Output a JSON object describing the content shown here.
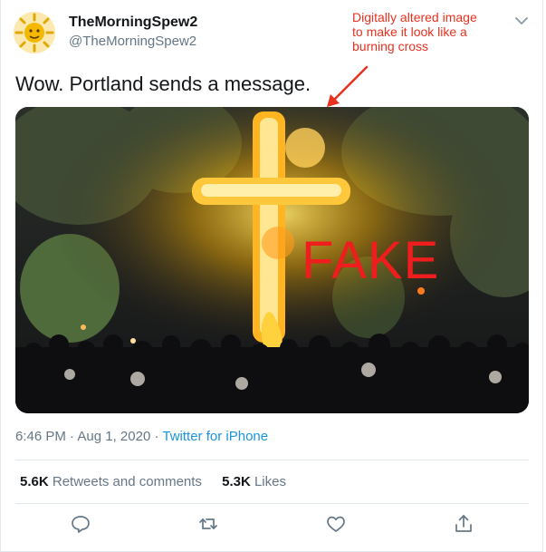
{
  "user": {
    "display_name": "TheMorningSpew2",
    "handle": "@TheMorningSpew2",
    "avatar_icon": "sun-face-icon"
  },
  "annotation": {
    "text": "Digitally  altered image\nto  make it look like a\nburning cross",
    "color": "#e8311f"
  },
  "tweet": {
    "text": "Wow. Portland sends a message.",
    "media_overlay_text": "FAKE",
    "time": "6:46 PM",
    "separator": "·",
    "date": "Aug 1, 2020",
    "source": "Twitter for iPhone"
  },
  "stats": {
    "retweets_count": "5.6K",
    "retweets_label": "Retweets and comments",
    "likes_count": "5.3K",
    "likes_label": "Likes"
  },
  "actions": [
    "reply-icon",
    "retweet-icon",
    "like-icon",
    "share-icon"
  ],
  "colors": {
    "accent": "#1b95e0",
    "muted": "#657786",
    "fake_text": "#ef1d1d"
  }
}
